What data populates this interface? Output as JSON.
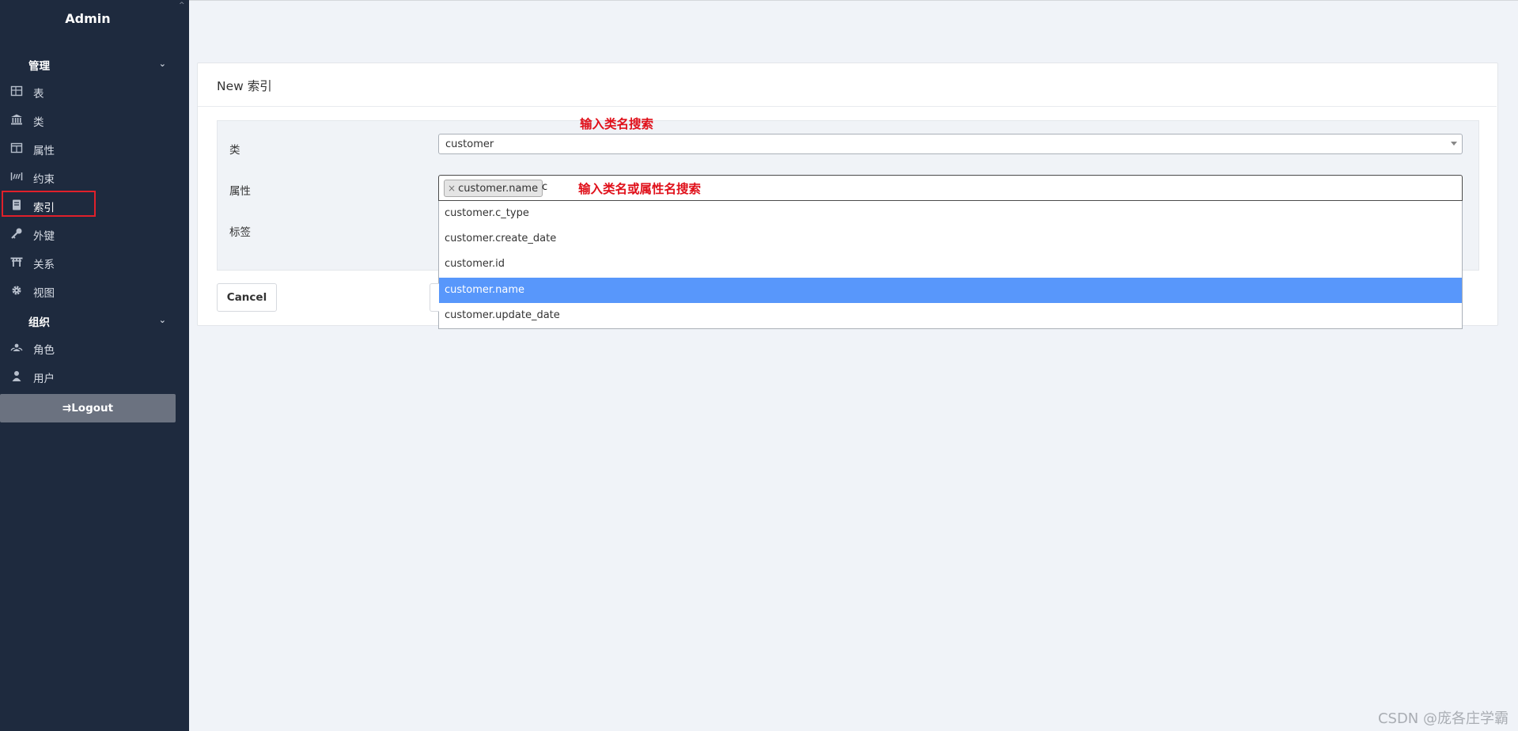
{
  "sidebar": {
    "brand": "Admin",
    "groups": {
      "manage": "管理",
      "org": "组织"
    },
    "items": [
      {
        "label": "表",
        "icon": "table-icon"
      },
      {
        "label": "类",
        "icon": "bank-icon"
      },
      {
        "label": "属性",
        "icon": "columns-icon"
      },
      {
        "label": "约束",
        "icon": "fence-icon"
      },
      {
        "label": "索引",
        "icon": "book-icon"
      },
      {
        "label": "外键",
        "icon": "key-icon"
      },
      {
        "label": "关系",
        "icon": "torii-icon"
      },
      {
        "label": "视图",
        "icon": "gear-icon"
      },
      {
        "label": "角色",
        "icon": "users-icon"
      },
      {
        "label": "用户",
        "icon": "user-icon"
      }
    ],
    "active_item": "索引",
    "logout": "Logout"
  },
  "form": {
    "title": "New 索引",
    "labels": {
      "class": "类",
      "attribute": "属性",
      "tag": "标签"
    },
    "class_value": "customer",
    "attribute_tag": "customer.name",
    "attribute_tag_remove": "×",
    "attribute_typed": "c",
    "options": [
      "customer.c_type",
      "customer.create_date",
      "customer.id",
      "customer.name",
      "customer.update_date"
    ],
    "highlighted_option": "customer.name",
    "cancel": "Cancel"
  },
  "annotations": {
    "class_hint": "输入类名搜索",
    "attribute_hint": "输入类名或属性名搜索"
  },
  "watermark": "CSDN @庞各庄学霸",
  "colors": {
    "sidebar_bg": "#1e2a3e",
    "highlight": "#5897fb",
    "annotation_red": "#e0101a"
  }
}
